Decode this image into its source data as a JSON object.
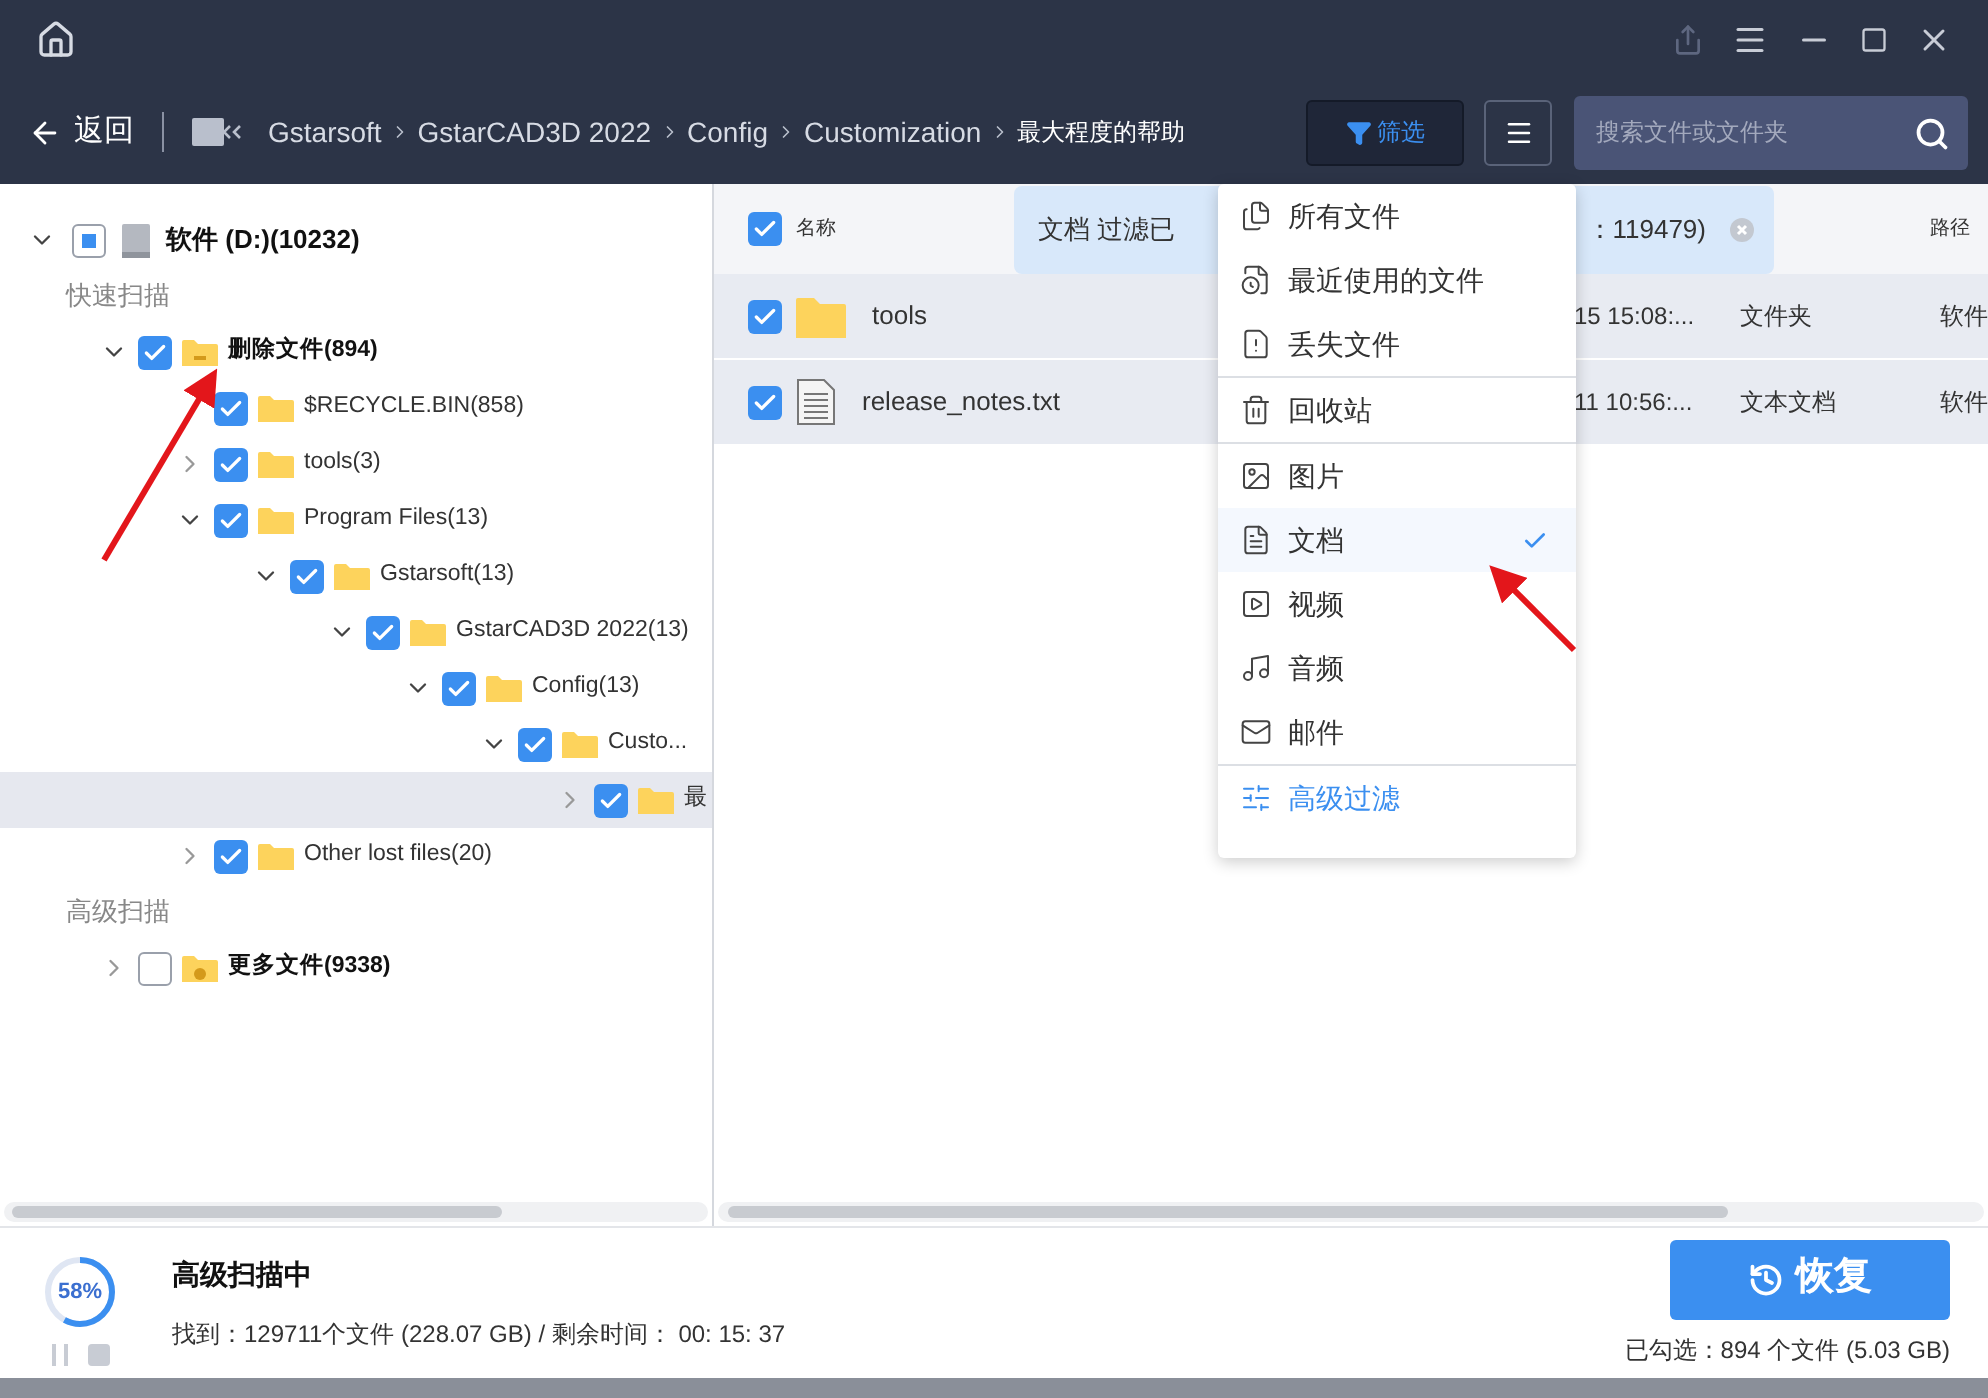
{
  "nav": {
    "back": "返回",
    "breadcrumbs": [
      {
        "label": "Gstarsoft",
        "current": false
      },
      {
        "label": "GstarCAD3D 2022",
        "current": false
      },
      {
        "label": "Config",
        "current": false
      },
      {
        "label": "Customization",
        "current": false
      },
      {
        "label": "最大程度的帮助",
        "current": true
      }
    ],
    "filter_button": "筛选",
    "search": {
      "placeholder": "搜索文件或文件夹"
    }
  },
  "tree": {
    "root": {
      "label": "软件 (D:)(10232)",
      "partial": true,
      "expanded": true
    },
    "sections": [
      {
        "title": "快速扫描",
        "items": [
          {
            "label": "删除文件(894)",
            "kind": "deleted",
            "checked": true,
            "expanded": true,
            "selected": false,
            "children": [
              {
                "label": "$RECYCLE.BIN(858)",
                "kind": "leaf",
                "checked": true,
                "selected": false
              },
              {
                "label": "tools(3)",
                "kind": "folder",
                "checked": true,
                "expanded": false,
                "selected": false
              },
              {
                "label": "Program Files(13)",
                "kind": "folder",
                "checked": true,
                "expanded": true,
                "selected": false,
                "children": [
                  {
                    "label": "Gstarsoft(13)",
                    "kind": "folder",
                    "checked": true,
                    "expanded": true,
                    "selected": false,
                    "children": [
                      {
                        "label": "GstarCAD3D 2022(13)",
                        "kind": "folder",
                        "checked": true,
                        "expanded": true,
                        "selected": false,
                        "children": [
                          {
                            "label": "Config(13)",
                            "kind": "folder",
                            "checked": true,
                            "expanded": true,
                            "selected": false,
                            "children": [
                              {
                                "label": "Custo...",
                                "kind": "folder",
                                "checked": true,
                                "expanded": true,
                                "selected": false,
                                "children": [
                                  {
                                    "label": "最",
                                    "kind": "folder",
                                    "checked": true,
                                    "expanded": false,
                                    "selected": true
                                  }
                                ]
                              }
                            ]
                          }
                        ]
                      }
                    ]
                  }
                ]
              },
              {
                "label": "Other lost files(20)",
                "kind": "folder",
                "checked": true,
                "expanded": false,
                "selected": false
              }
            ]
          }
        ]
      },
      {
        "title": "高级扫描",
        "items": [
          {
            "label": "更多文件(9338)",
            "kind": "more",
            "checked": false,
            "expanded": false,
            "selected": false
          }
        ]
      }
    ]
  },
  "table": {
    "all_checked": true,
    "columns": [
      "名称",
      "路径"
    ],
    "rows": [
      {
        "kind": "folder",
        "checked": true,
        "name": "tools",
        "date": "15 15:08:...",
        "type": "文件夹",
        "path": "软件"
      },
      {
        "kind": "text",
        "checked": true,
        "name": "release_notes.txt",
        "date": "11 10:56:...",
        "type": "文本文档",
        "path": "软件"
      }
    ]
  },
  "banner": {
    "text_left": "文档 过滤已",
    "text_right": "：119479)"
  },
  "filter_menu": {
    "groups": [
      [
        {
          "kind": "all",
          "label": "所有文件",
          "selected": false
        },
        {
          "kind": "recent",
          "label": "最近使用的文件",
          "selected": false
        },
        {
          "kind": "lost",
          "label": "丢失文件",
          "selected": false
        }
      ],
      [
        {
          "kind": "recycle",
          "label": "回收站",
          "selected": false
        }
      ],
      [
        {
          "kind": "image",
          "label": "图片",
          "selected": false
        },
        {
          "kind": "doc",
          "label": "文档",
          "selected": true
        },
        {
          "kind": "video",
          "label": "视频",
          "selected": false
        },
        {
          "kind": "audio",
          "label": "音频",
          "selected": false
        },
        {
          "kind": "mail",
          "label": "邮件",
          "selected": false
        }
      ],
      [
        {
          "kind": "advanced",
          "label": "高级过滤",
          "selected": false
        }
      ]
    ]
  },
  "scan": {
    "percent": "58%",
    "level": 0.58,
    "title": "高级扫描中",
    "found": "找到：129711个文件 (228.07 GB) / 剩余时间：  00: 15: 37",
    "recover": "恢复",
    "selected_info": "已勾选：894 个文件 (5.03 GB)"
  }
}
